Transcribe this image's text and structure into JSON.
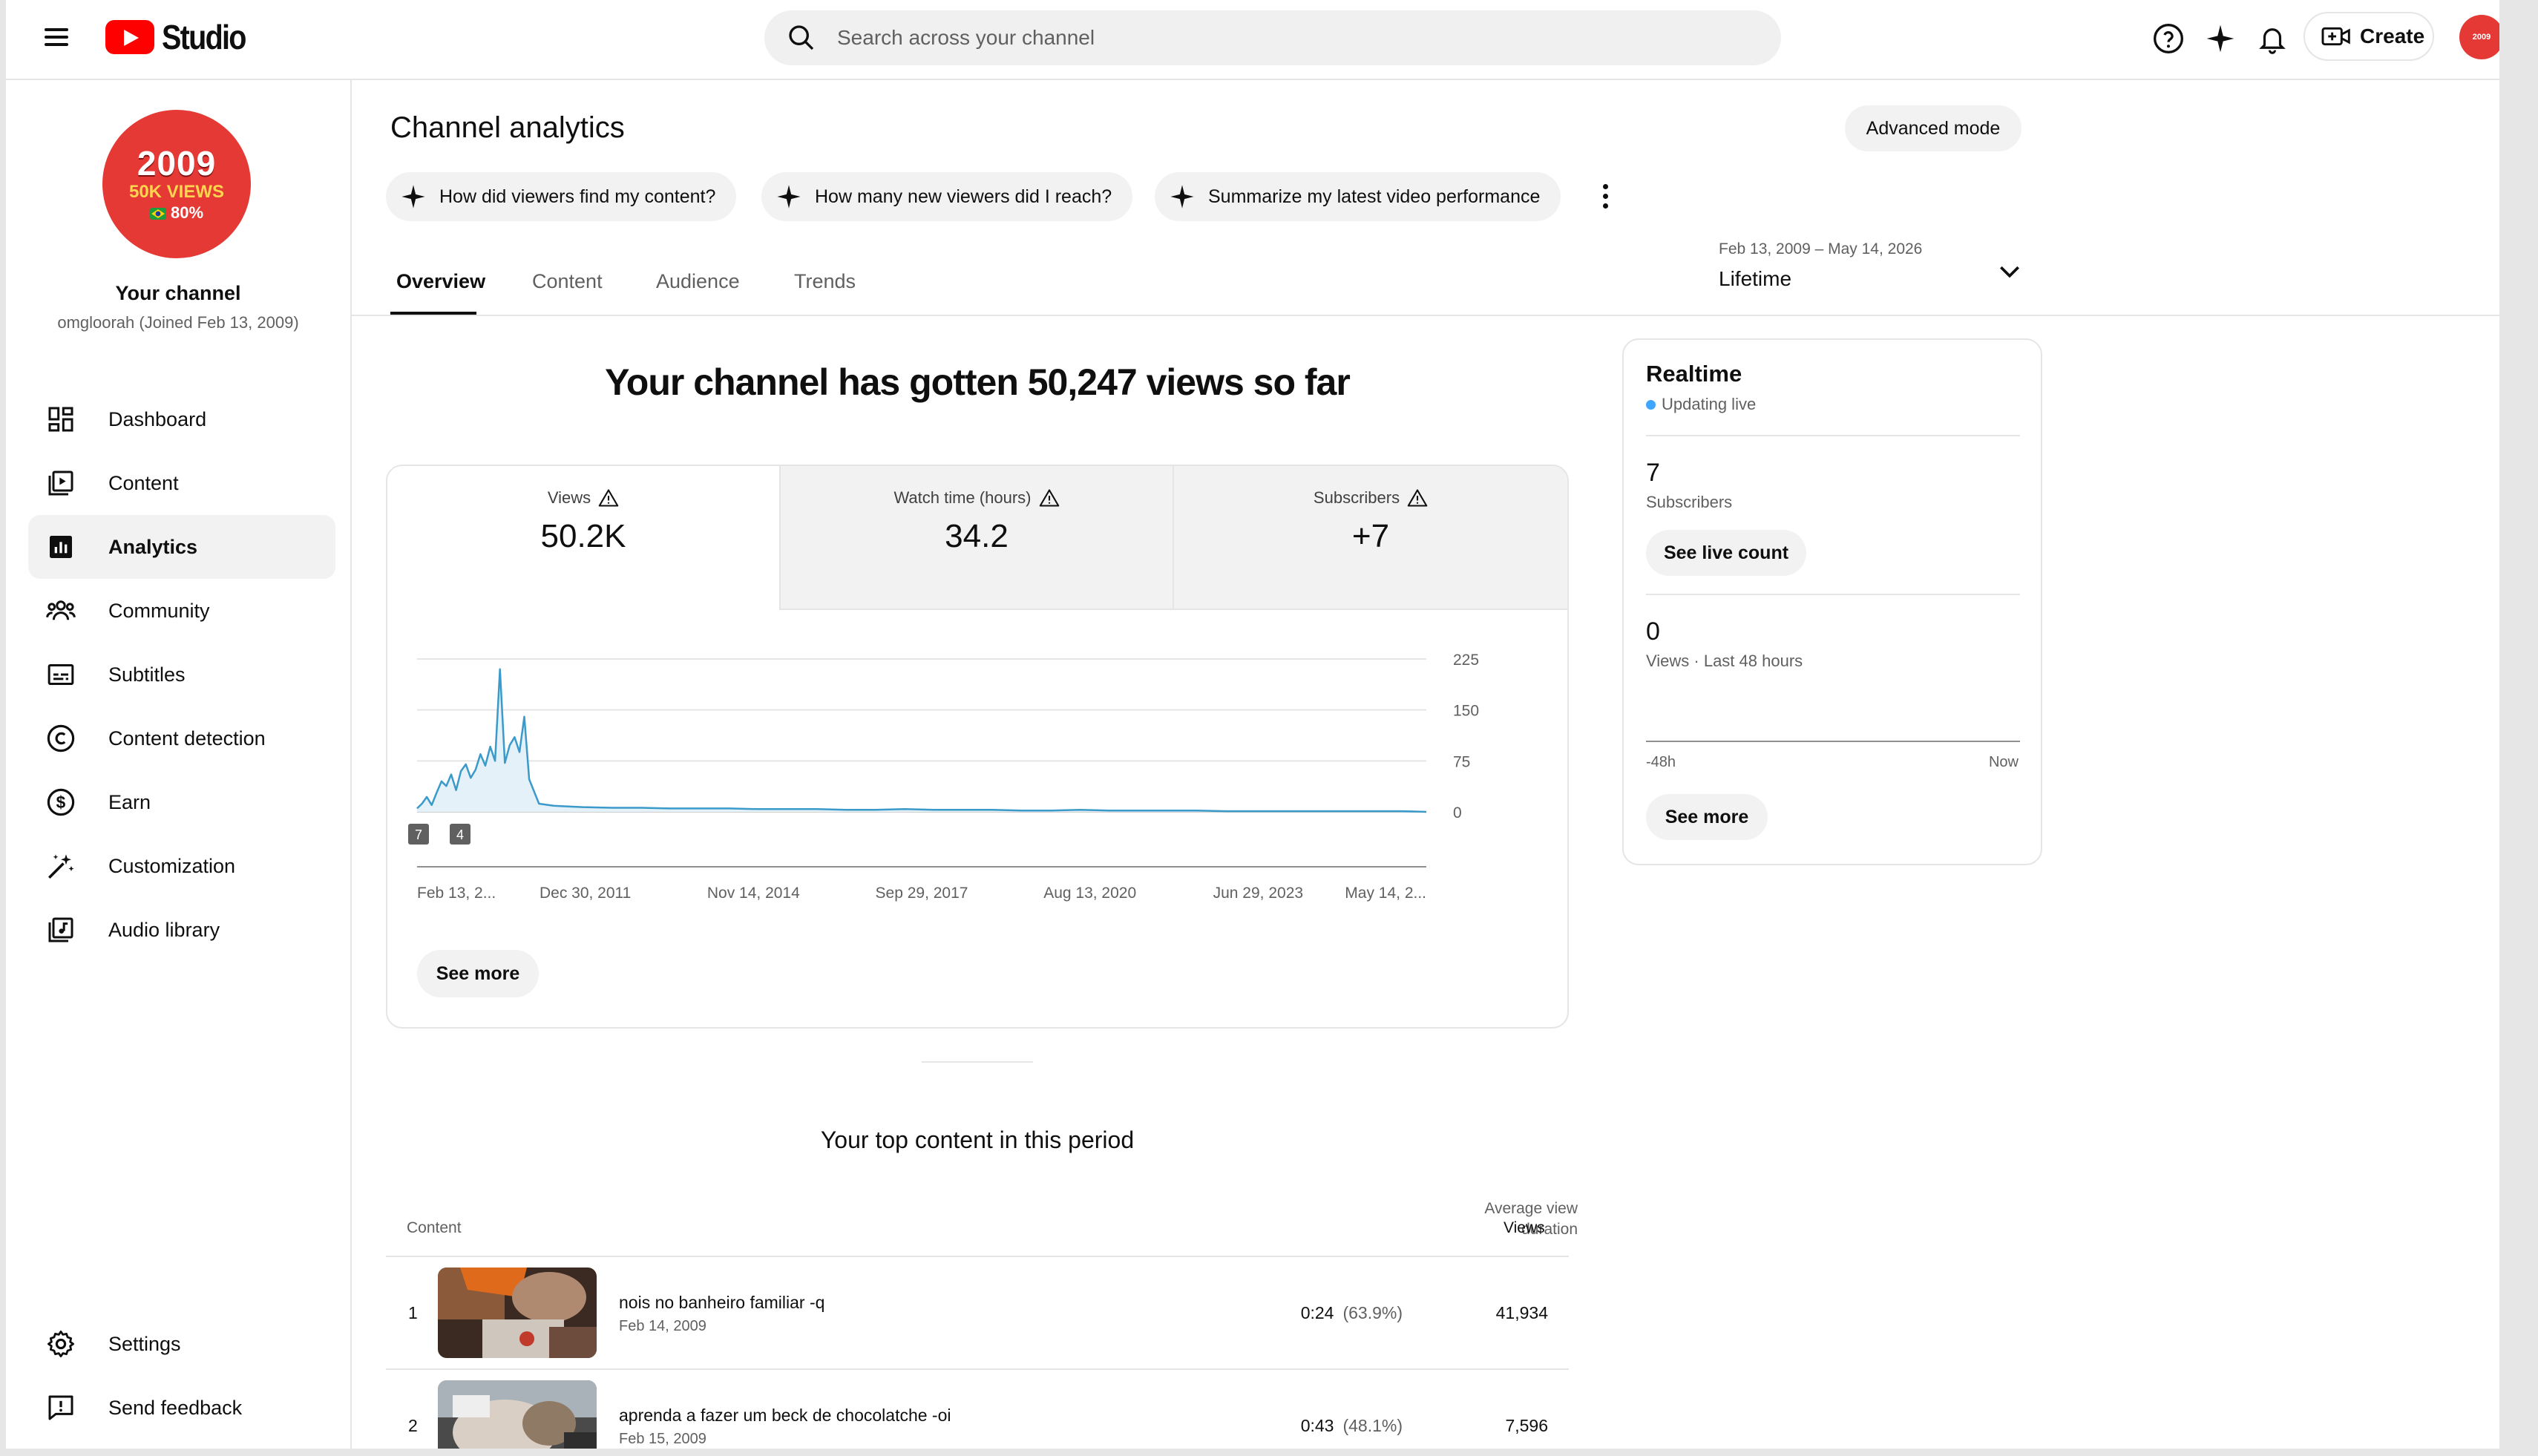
{
  "header": {
    "logo_text": "Studio",
    "search_placeholder": "Search across your channel",
    "create_label": "Create",
    "avatar_text": "2009"
  },
  "sidebar": {
    "avatar": {
      "line1": "2009",
      "line2": "50K VIEWS",
      "line3": "80%"
    },
    "channel_name": "Your channel",
    "channel_sub": "omgloorah (Joined Feb 13, 2009)",
    "items": [
      {
        "label": "Dashboard",
        "icon": "dashboard-icon"
      },
      {
        "label": "Content",
        "icon": "content-icon"
      },
      {
        "label": "Analytics",
        "icon": "analytics-icon",
        "active": true
      },
      {
        "label": "Community",
        "icon": "community-icon"
      },
      {
        "label": "Subtitles",
        "icon": "subtitles-icon"
      },
      {
        "label": "Content detection",
        "icon": "copyright-icon"
      },
      {
        "label": "Earn",
        "icon": "dollar-icon"
      },
      {
        "label": "Customization",
        "icon": "magic-wand-icon"
      },
      {
        "label": "Audio library",
        "icon": "audio-library-icon"
      }
    ],
    "bottom_items": [
      {
        "label": "Settings",
        "icon": "gear-icon"
      },
      {
        "label": "Send feedback",
        "icon": "feedback-icon"
      }
    ]
  },
  "main": {
    "title": "Channel analytics",
    "advanced_mode_label": "Advanced mode",
    "ai_chips": [
      "How did viewers find my content?",
      "How many new viewers did I reach?",
      "Summarize my latest video performance"
    ],
    "tabs": [
      "Overview",
      "Content",
      "Audience",
      "Trends"
    ],
    "active_tab": "Overview",
    "date_range": {
      "range": "Feb 13, 2009 – May 14, 2026",
      "label": "Lifetime"
    },
    "headline": "Your channel has gotten 50,247 views so far",
    "metrics": [
      {
        "label": "Views",
        "value": "50.2K",
        "selected": true
      },
      {
        "label": "Watch time (hours)",
        "value": "34.2"
      },
      {
        "label": "Subscribers",
        "value": "+7"
      }
    ],
    "see_more_label": "See more"
  },
  "chart_data": {
    "type": "line",
    "series_name": "Views",
    "y_ticks": [
      "225",
      "150",
      "75",
      "0"
    ],
    "ylim": [
      0,
      225
    ],
    "x_tick_labels": [
      "Feb 13, 2...",
      "Dec 30, 2011",
      "Nov 14, 2014",
      "Sep 29, 2017",
      "Aug 13, 2020",
      "Jun 29, 2023",
      "May 14, 2..."
    ],
    "markers": [
      "7",
      "4"
    ],
    "x": [
      "2009-02",
      "2009-03",
      "2009-04",
      "2009-05",
      "2009-06",
      "2009-07",
      "2009-08",
      "2009-09",
      "2009-10",
      "2009-11",
      "2009-12",
      "2010-01",
      "2010-02",
      "2010-03",
      "2010-04",
      "2010-05",
      "2010-06",
      "2010-07",
      "2010-08",
      "2010-09",
      "2010-10",
      "2010-11",
      "2010-12",
      "2011-01",
      "2011-03",
      "2011-06",
      "2011-09",
      "2011-12",
      "2012-06",
      "2012-12",
      "2013-06",
      "2013-12",
      "2014-06",
      "2014-12",
      "2015-06",
      "2015-12",
      "2016-06",
      "2016-12",
      "2017-06",
      "2017-12",
      "2018-06",
      "2018-12",
      "2019-06",
      "2019-12",
      "2020-06",
      "2020-12",
      "2021-06",
      "2021-12",
      "2022-06",
      "2022-12",
      "2023-06",
      "2023-12",
      "2024-06",
      "2024-12",
      "2025-06",
      "2025-12",
      "2026-05"
    ],
    "y": [
      5,
      12,
      22,
      10,
      28,
      45,
      38,
      55,
      32,
      60,
      70,
      50,
      62,
      85,
      68,
      96,
      75,
      210,
      72,
      98,
      110,
      88,
      140,
      48,
      12,
      9,
      8,
      7,
      6,
      6,
      5,
      5,
      5,
      4,
      4,
      4,
      3,
      3,
      4,
      3,
      3,
      3,
      2,
      2,
      3,
      2,
      2,
      2,
      2,
      1,
      1,
      1,
      1,
      1,
      1,
      1,
      0
    ]
  },
  "realtime": {
    "title": "Realtime",
    "status": "Updating live",
    "subscribers_value": "7",
    "subscribers_label": "Subscribers",
    "see_live_label": "See live count",
    "views_value": "0",
    "views_label": "Views · Last 48 hours",
    "axis_start": "-48h",
    "axis_end": "Now",
    "see_more_label": "See more"
  },
  "top_content": {
    "title": "Your top content in this period",
    "col_content": "Content",
    "col_avd_1": "Average view",
    "col_avd_2": "duration",
    "col_views": "Views",
    "rows": [
      {
        "index": "1",
        "title": "nois no banheiro familiar -q",
        "date": "Feb 14, 2009",
        "avd": "0:24",
        "avd_pct": "(63.9%)",
        "views": "41,934"
      },
      {
        "index": "2",
        "title": "aprenda a fazer um beck de chocolatche -oi",
        "date": "Feb 15, 2009",
        "avd": "0:43",
        "avd_pct": "(48.1%)",
        "views": "7,596"
      }
    ]
  },
  "colors": {
    "accent": "#ff0000",
    "chart_line": "#3b9ac9",
    "chart_fill": "#e4f1f8",
    "live_dot": "#3ea6ff"
  }
}
